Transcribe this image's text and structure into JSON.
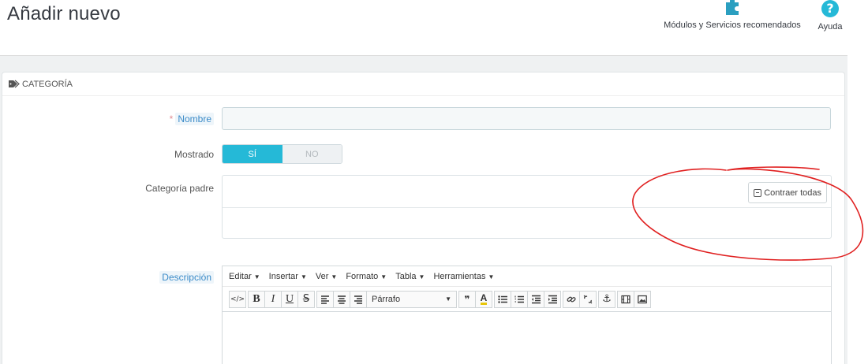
{
  "header": {
    "title": "Añadir nuevo",
    "modules_label": "Módulos y Servicios recomendados",
    "help_label": "Ayuda",
    "help_glyph": "?",
    "icons": {
      "modules": "puzzle-icon",
      "help": "question-circle-icon"
    }
  },
  "panel": {
    "heading": "CATEGORÍA",
    "heading_icon": "tags-icon"
  },
  "form": {
    "name_label": "Nombre",
    "required_mark": "*",
    "name_value": "",
    "displayed_label": "Mostrado",
    "switch_on": "SÍ",
    "switch_off": "NO",
    "switch_selected": "SÍ",
    "parent_label": "Categoría padre",
    "collapse_all": "Contraer todas",
    "description_label": "Descripción"
  },
  "editor": {
    "menus": [
      "Editar",
      "Insertar",
      "Ver",
      "Formato",
      "Tabla",
      "Herramientas"
    ],
    "format_value": "Párrafo",
    "toolbar_buttons": [
      "source-code",
      "bold",
      "italic",
      "underline",
      "strikethrough",
      "align-left",
      "align-center",
      "align-right",
      "format-select",
      "blockquote",
      "text-color",
      "bullet-list",
      "numbered-list",
      "outdent",
      "indent",
      "link",
      "unlink",
      "anchor",
      "media",
      "image"
    ]
  },
  "colors": {
    "accent": "#25b9d7",
    "annotation": "#e02020",
    "background": "#eff1f2"
  }
}
